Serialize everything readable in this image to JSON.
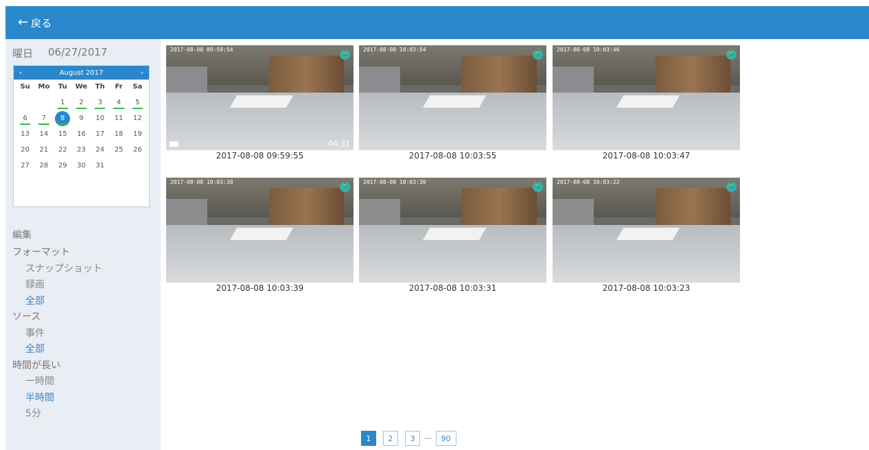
{
  "header": {
    "back_label": "戻る",
    "back_icon": "arrow-left-icon"
  },
  "sidebar": {
    "date_label": "曜日",
    "date_value": "06/27/2017",
    "calendar": {
      "month": "August 2017",
      "prev": "‹",
      "next": "›",
      "weekdays": [
        "Su",
        "Mo",
        "Tu",
        "We",
        "Th",
        "Fr",
        "Sa"
      ],
      "days": [
        "",
        "",
        "1",
        "2",
        "3",
        "4",
        "5",
        "6",
        "7",
        "8",
        "9",
        "10",
        "11",
        "12",
        "13",
        "14",
        "15",
        "16",
        "17",
        "18",
        "19",
        "20",
        "21",
        "22",
        "23",
        "24",
        "25",
        "26",
        "27",
        "28",
        "29",
        "30",
        "31",
        "",
        ""
      ],
      "marked_days": [
        "1",
        "2",
        "3",
        "4",
        "5",
        "6",
        "7",
        "8"
      ],
      "selected_day": "8"
    },
    "filters": {
      "edit": "編集",
      "format": "フォーマット",
      "snapshot": "スナップショット",
      "recording": "録画",
      "all_format": "全部",
      "source": "ソース",
      "event": "事件",
      "all_source": "全部",
      "duration": "時間が長い",
      "one_hour": "一時間",
      "half_hour": "半時間",
      "five_min": "5分"
    }
  },
  "thumbnails": [
    {
      "caption": "2017-08-08 09:59:55",
      "overlay": "2017-08-08 09:59:54",
      "duration": "04:31"
    },
    {
      "caption": "2017-08-08 10:03:55",
      "overlay": "2017-08-08 10:03:54",
      "duration": ""
    },
    {
      "caption": "2017-08-08 10:03:47",
      "overlay": "2017-08-08 10:03:46",
      "duration": ""
    },
    {
      "caption": "2017-08-08 10:03:39",
      "overlay": "2017-08-08 10:03:38",
      "duration": ""
    },
    {
      "caption": "2017-08-08 10:03:31",
      "overlay": "2017-08-08 10:03:30",
      "duration": ""
    },
    {
      "caption": "2017-08-08 10:03:23",
      "overlay": "2017-08-08 10:03:22",
      "duration": ""
    }
  ],
  "pagination": {
    "pages": [
      "1",
      "2",
      "3"
    ],
    "ellipsis": "···",
    "last": "90",
    "current": "1"
  },
  "colors": {
    "accent": "#2a87cc",
    "marker": "#2fbf4a",
    "motion_badge": "#2bb7a9"
  }
}
